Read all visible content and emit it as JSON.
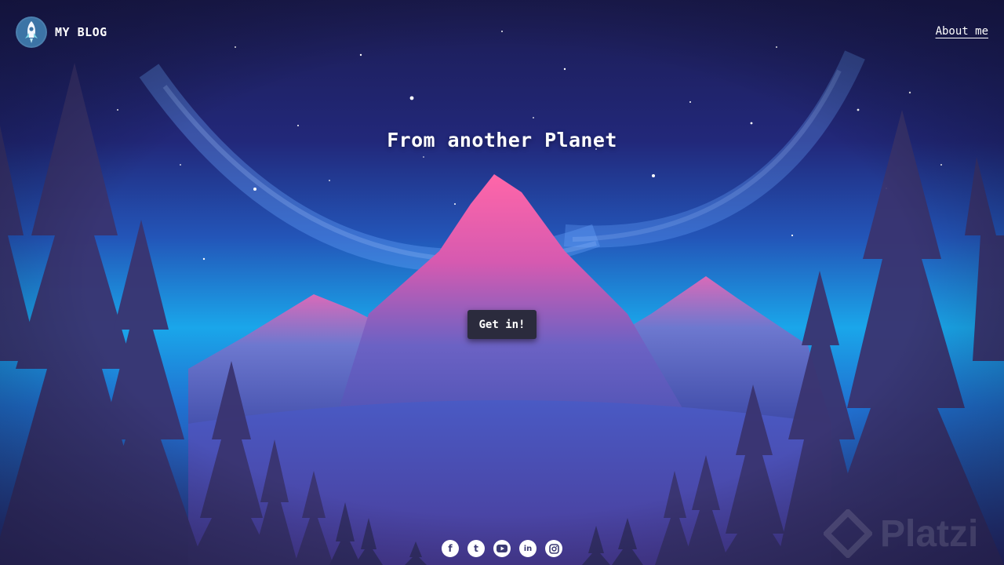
{
  "header": {
    "brand": "MY BLOG",
    "about_link": "About me"
  },
  "hero": {
    "title": "From another Planet",
    "cta_label": "Get in!"
  },
  "social": {
    "facebook": "f",
    "tumblr": "t",
    "youtube_icon": "youtube-icon",
    "linkedin": "in",
    "instagram_icon": "instagram-icon"
  },
  "watermark": {
    "text": "Platzi"
  },
  "colors": {
    "sky_top": "#1c1c52",
    "sky_mid": "#2b3ea6",
    "horizon": "#1db6ef",
    "peak": "#ff5fa8",
    "trees": "#3a3470",
    "button": "#2b2b3d"
  }
}
